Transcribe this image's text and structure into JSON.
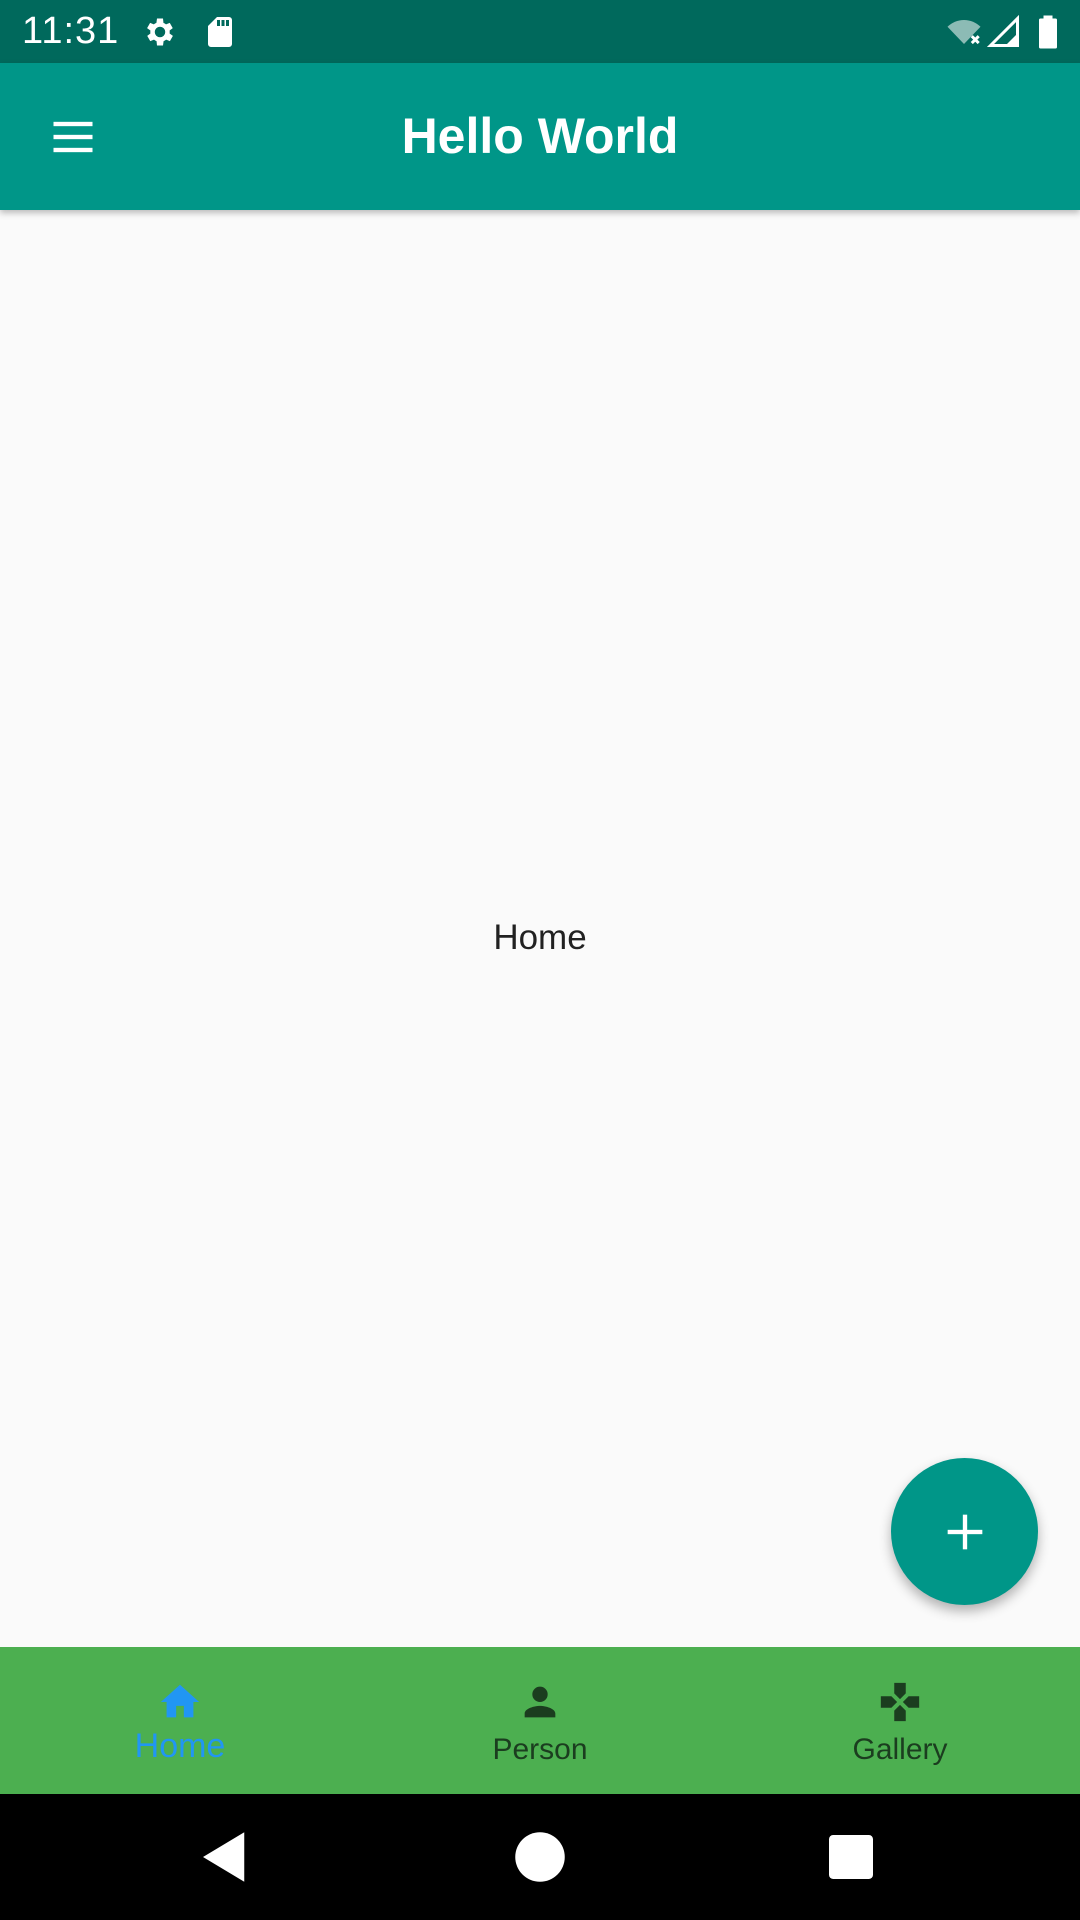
{
  "status_bar": {
    "time": "11:31",
    "icons": [
      "gear-icon",
      "sd-card-icon",
      "wifi-off-icon",
      "signal-icon",
      "battery-icon"
    ]
  },
  "app_bar": {
    "title": "Hello World",
    "menu_icon": "menu-icon"
  },
  "content": {
    "text": "Home"
  },
  "fab": {
    "icon": "plus-icon"
  },
  "bottom_nav": {
    "items": [
      {
        "label": "Home",
        "icon": "home-icon",
        "active": true
      },
      {
        "label": "Person",
        "icon": "person-icon",
        "active": false
      },
      {
        "label": "Gallery",
        "icon": "gamepad-icon",
        "active": false
      }
    ]
  },
  "system_nav": {
    "buttons": [
      "back-icon",
      "home-circle-icon",
      "recents-icon"
    ]
  },
  "colors": {
    "status_bar": "#00695c",
    "app_bar": "#009688",
    "fab": "#009688",
    "bottom_nav": "#4caf50",
    "active_nav": "#2196f3",
    "inactive_nav": "#1b3d1f",
    "background": "#fafafa"
  }
}
